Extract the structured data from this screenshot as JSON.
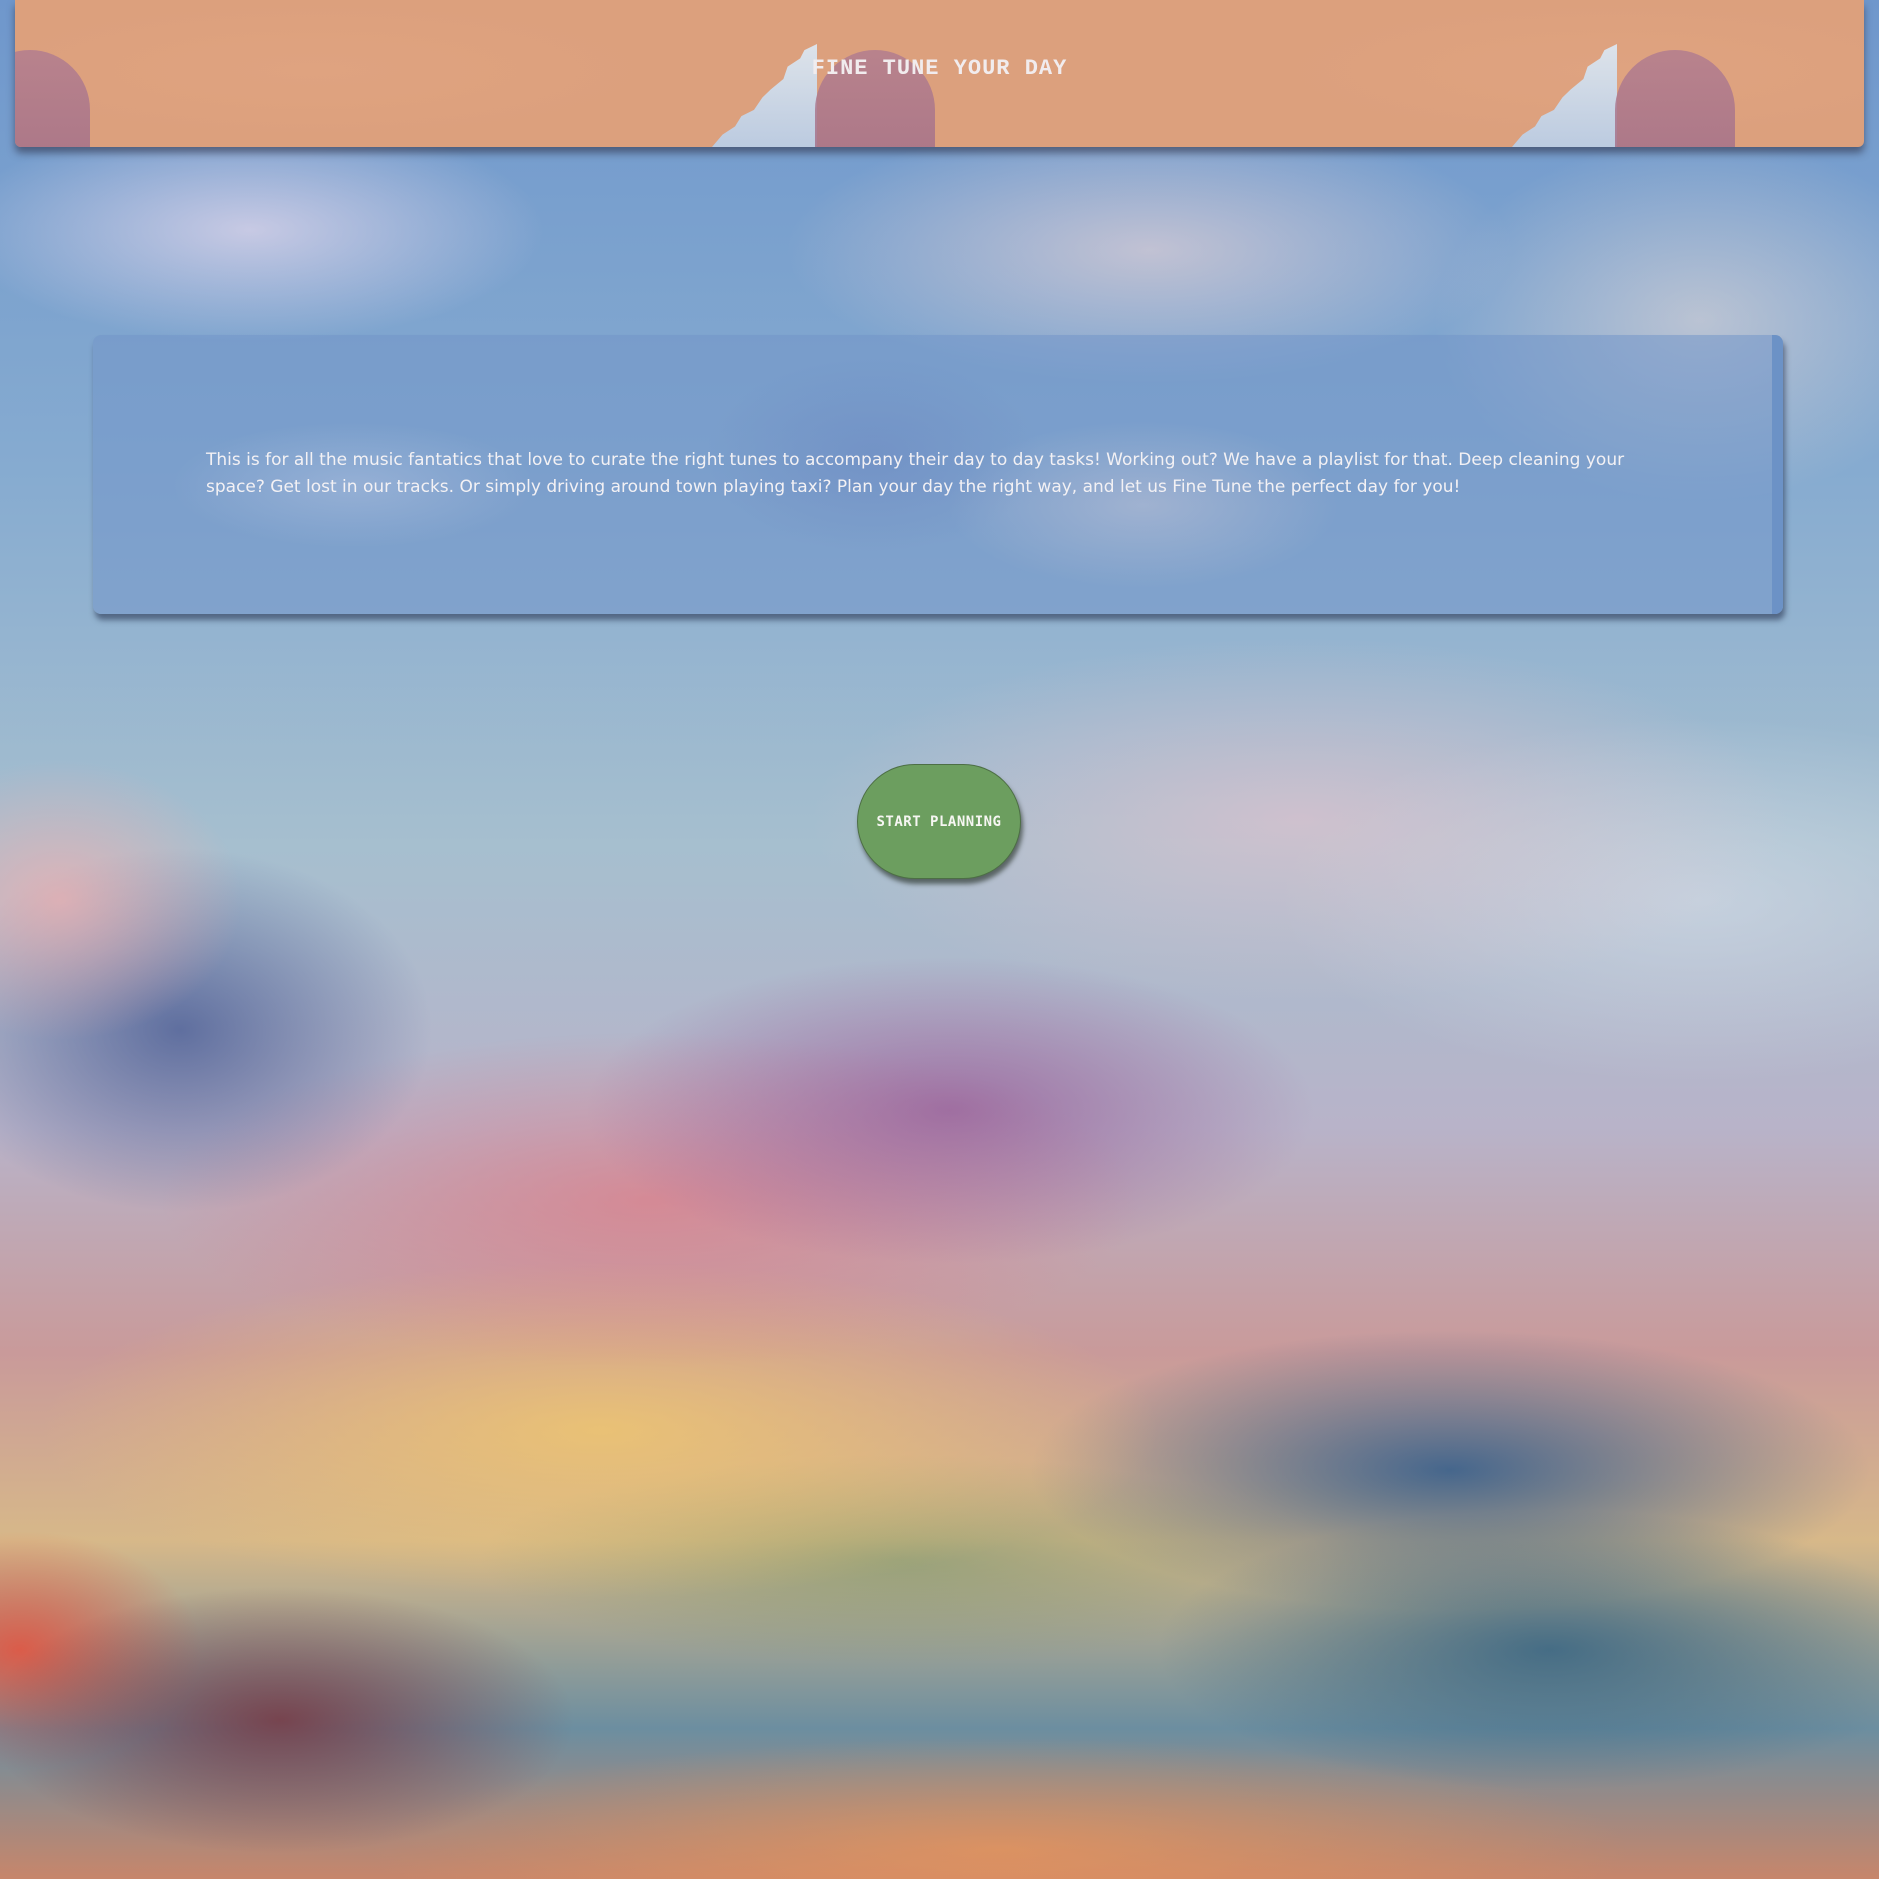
{
  "header": {
    "title": "FINE TUNE YOUR DAY",
    "background_color": "#dca07d"
  },
  "intro": {
    "text": "This is for all the music fantatics that love to curate the right tunes to accompany their day to day tasks! Working out? We have a playlist for that. Deep cleaning your space? Get lost in our tracks. Or simply driving around town playing taxi? Plan your day the right way, and let us Fine Tune the perfect day for you!"
  },
  "cta": {
    "label": "START PLANNING",
    "color": "#6c9e5f"
  }
}
